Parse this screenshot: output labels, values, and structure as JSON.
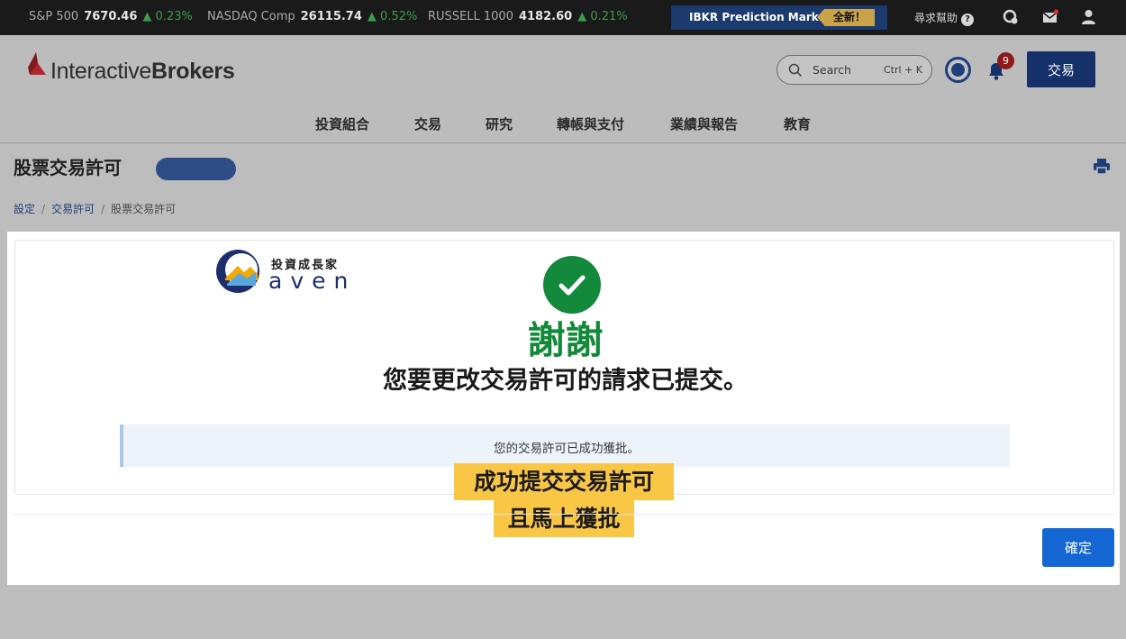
{
  "ticker": [
    {
      "name": "S&P 500",
      "value": "7670.46",
      "change": "0.23%"
    },
    {
      "name": "NASDAQ Comp",
      "value": "26115.74",
      "change": "0.52%"
    },
    {
      "name": "RUSSELL 1000",
      "value": "4182.60",
      "change": "0.21%"
    }
  ],
  "promo": {
    "label": "IBKR Prediction Markets",
    "tag": "全新！"
  },
  "topbar": {
    "help_label": "尋求幫助",
    "help_icon": "?"
  },
  "header": {
    "logo_text_light": "Interactive",
    "logo_text_bold": "Brokers",
    "search_label": "Search",
    "search_shortcut": "Ctrl + K",
    "notifications_count": "9",
    "trade_button": "交易"
  },
  "nav": [
    "投資組合",
    "交易",
    "研究",
    "轉帳與支付",
    "業績與報告",
    "教育"
  ],
  "page": {
    "title": "股票交易許可",
    "breadcrumbs": [
      "設定",
      "交易許可",
      "股票交易許可"
    ]
  },
  "watermark": {
    "zh": "投資成長家",
    "en": "aven"
  },
  "confirmation": {
    "thanks": "謝謝",
    "message": "您要更改交易許可的請求已提交。",
    "notice": "您的交易許可已成功獲批。",
    "highlight_line1": "成功提交交易許可",
    "highlight_line2": "且馬上獲批",
    "ok_button": "確定"
  },
  "colors": {
    "accent": "#16306a",
    "success": "#138a3b",
    "highlight": "#f9c646",
    "primary_button": "#1466d3"
  }
}
